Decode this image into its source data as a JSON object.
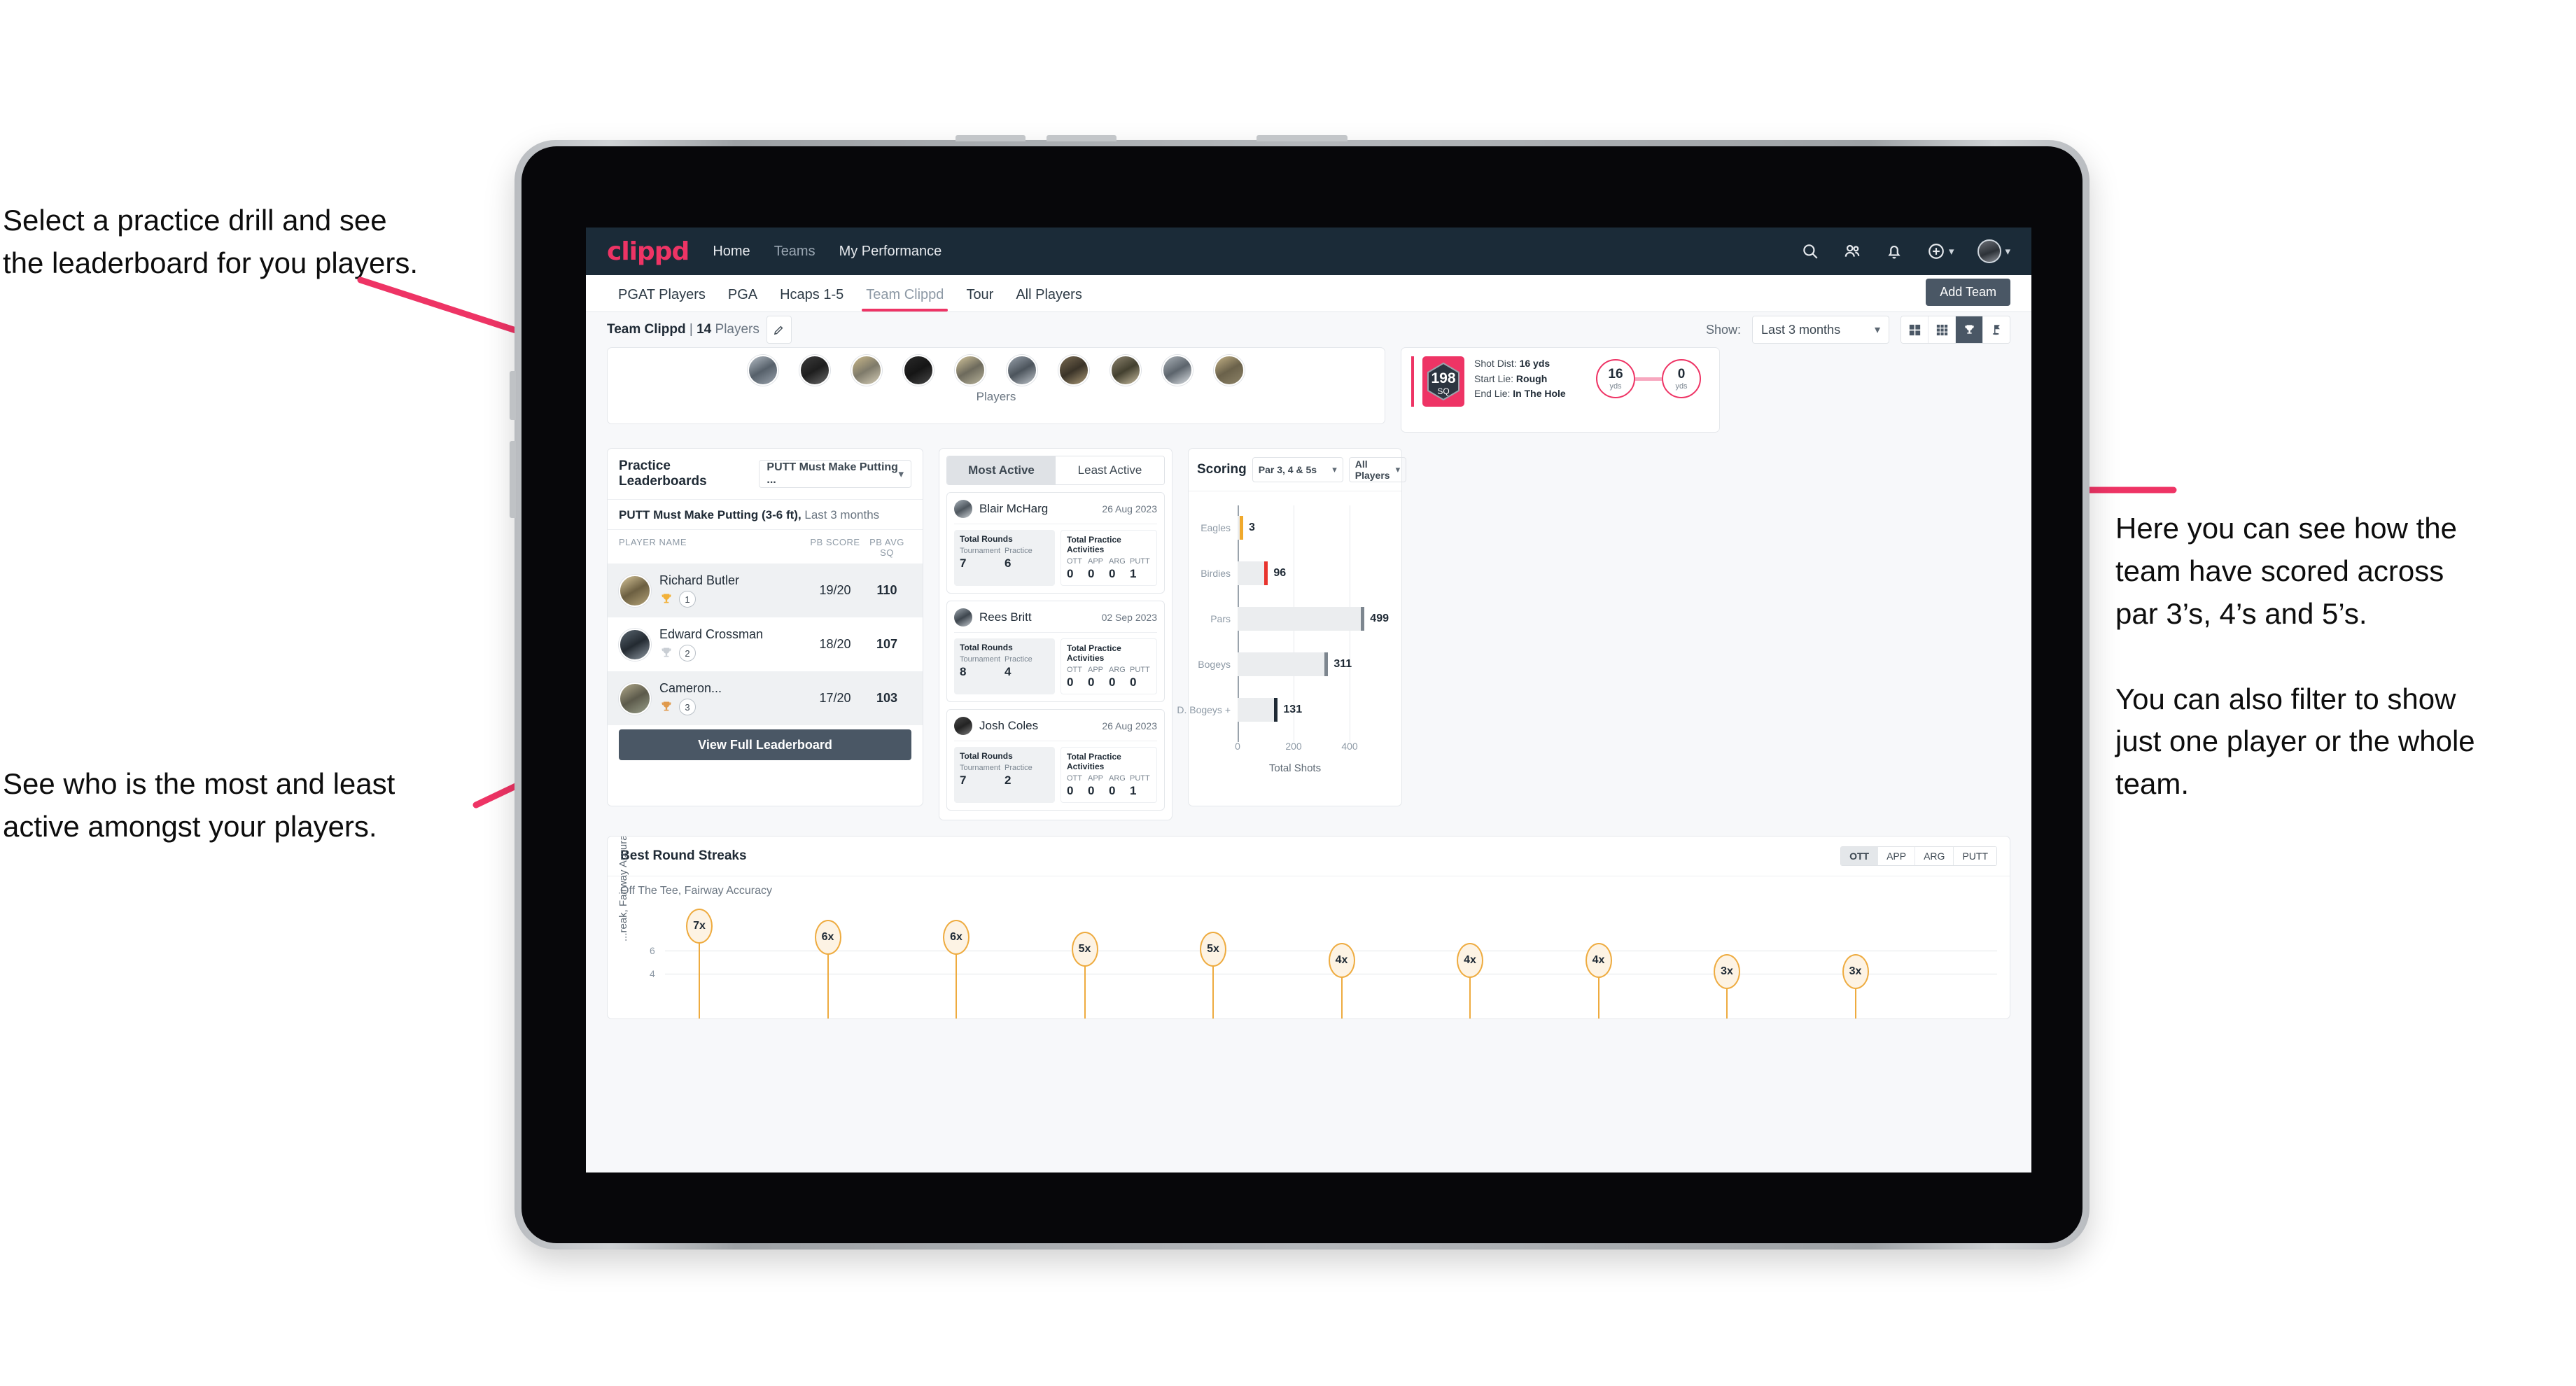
{
  "annotations": {
    "left_top": "Select a practice drill and see\nthe leaderboard for you players.",
    "left_bottom": "See who is the most and least\nactive amongst your players.",
    "right": "Here you can see how the\nteam have scored across\npar 3’s, 4’s and 5’s.\n\nYou can also filter to show\njust one player or the whole\nteam.",
    "arrow_color": "#ee3465"
  },
  "app": {
    "logo": "clippd",
    "nav": [
      {
        "label": "Home",
        "active": true
      },
      {
        "label": "Teams",
        "active": false
      },
      {
        "label": "My Performance",
        "active": true
      }
    ],
    "header_icons": [
      "search-icon",
      "people-icon",
      "bell-icon",
      "plus-circle-icon",
      "avatar"
    ],
    "tabs": [
      {
        "label": "PGAT Players",
        "active": false
      },
      {
        "label": "PGA",
        "active": false
      },
      {
        "label": "Hcaps 1-5",
        "active": false
      },
      {
        "label": "Team Clippd",
        "active": true
      },
      {
        "label": "Tour",
        "active": false
      },
      {
        "label": "All Players",
        "active": false
      }
    ],
    "add_team_label": "Add Team"
  },
  "toolbar": {
    "team_name": "Team Clippd",
    "team_separator": " | ",
    "player_count": "14",
    "players_word": " Players",
    "edit_icon": "pencil-icon",
    "show_label": "Show:",
    "show_value": "Last 3 months",
    "view_toggles": [
      {
        "icon": "grid-2x2-icon",
        "active": false
      },
      {
        "icon": "grid-3x3-icon",
        "active": false
      },
      {
        "icon": "trophy-icon",
        "active": true
      },
      {
        "icon": "golf-flag-icon",
        "active": false
      }
    ]
  },
  "players_card": {
    "caption": "Players",
    "avatar_count": 10
  },
  "shot_card": {
    "sq_value": "198",
    "sq_unit": "SQ",
    "lines": [
      {
        "label": "Shot Dist: ",
        "value": "16 yds"
      },
      {
        "label": "Start Lie: ",
        "value": "Rough"
      },
      {
        "label": "End Lie: ",
        "value": "In The Hole"
      }
    ],
    "start_yds": "16",
    "end_yds": "0",
    "unit": "yds"
  },
  "leaderboard": {
    "title": "Practice Leaderboards",
    "drill_select": "PUTT Must Make Putting ...",
    "subtitle_bold": "PUTT Must Make Putting (3-6 ft),",
    "subtitle_light": " Last 3 months",
    "columns": [
      "PLAYER NAME",
      "PB SCORE",
      "PB AVG SQ"
    ],
    "rows": [
      {
        "name": "Richard Butler",
        "rank": "1",
        "trophy": "gold",
        "score": "19/20",
        "avg": "110"
      },
      {
        "name": "Edward Crossman",
        "rank": "2",
        "trophy": "silver",
        "score": "18/20",
        "avg": "107"
      },
      {
        "name": "Cameron...",
        "rank": "3",
        "trophy": "bronze",
        "score": "17/20",
        "avg": "103"
      }
    ],
    "view_full_label": "View Full Leaderboard"
  },
  "activity": {
    "tabs": [
      {
        "label": "Most Active",
        "active": true
      },
      {
        "label": "Least Active",
        "active": false
      }
    ],
    "rounds_title": "Total Rounds",
    "practice_title": "Total Practice Activities",
    "rounds_cols": [
      "Tournament",
      "Practice"
    ],
    "practice_cols": [
      "OTT",
      "APP",
      "ARG",
      "PUTT"
    ],
    "players": [
      {
        "name": "Blair McHarg",
        "date": "26 Aug 2023",
        "tournament": "7",
        "practice": "6",
        "ott": "0",
        "app": "0",
        "arg": "0",
        "putt": "1"
      },
      {
        "name": "Rees Britt",
        "date": "02 Sep 2023",
        "tournament": "8",
        "practice": "4",
        "ott": "0",
        "app": "0",
        "arg": "0",
        "putt": "0"
      },
      {
        "name": "Josh Coles",
        "date": "26 Aug 2023",
        "tournament": "7",
        "practice": "2",
        "ott": "0",
        "app": "0",
        "arg": "0",
        "putt": "1"
      }
    ]
  },
  "scoring": {
    "title": "Scoring",
    "par_select": "Par 3, 4 & 5s",
    "player_select": "All Players"
  },
  "chart_data": {
    "type": "bar",
    "orientation": "horizontal",
    "title": "Scoring",
    "categories": [
      "Eagles",
      "Birdies",
      "Pars",
      "Bogeys",
      "D. Bogeys +"
    ],
    "values": [
      3,
      96,
      499,
      311,
      131
    ],
    "cap_colors": [
      "#f0a92c",
      "#e8342e",
      "#7d868f",
      "#7d868f",
      "#1f2a35"
    ],
    "xlabel": "Total Shots",
    "ylabel": "",
    "xlim": [
      0,
      540
    ],
    "xticks": [
      0,
      200,
      400
    ],
    "grid": true,
    "legend": "none"
  },
  "streaks": {
    "title": "Best Round Streaks",
    "toggle": [
      {
        "label": "OTT",
        "active": true
      },
      {
        "label": "APP",
        "active": false
      },
      {
        "label": "ARG",
        "active": false
      },
      {
        "label": "PUTT",
        "active": false
      }
    ],
    "subtitle_bold": "Off The Tee,",
    "subtitle_light": " Fairway Accuracy",
    "ylabel": "...reak, Fairway Accuracy",
    "yticks": [
      "6",
      "4"
    ],
    "points": [
      {
        "label": "7x",
        "value": 7
      },
      {
        "label": "6x",
        "value": 6
      },
      {
        "label": "6x",
        "value": 6
      },
      {
        "label": "5x",
        "value": 5
      },
      {
        "label": "5x",
        "value": 5
      },
      {
        "label": "4x",
        "value": 4
      },
      {
        "label": "4x",
        "value": 4
      },
      {
        "label": "4x",
        "value": 4
      },
      {
        "label": "3x",
        "value": 3
      },
      {
        "label": "3x",
        "value": 3
      }
    ]
  }
}
